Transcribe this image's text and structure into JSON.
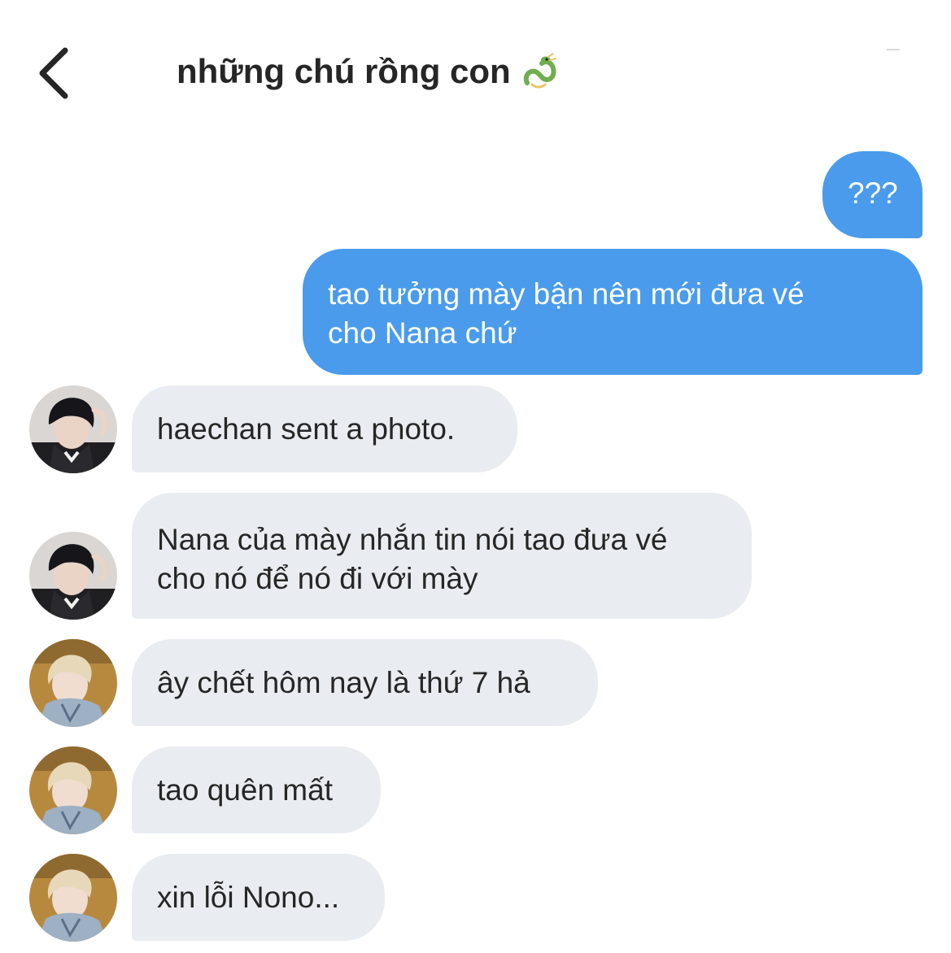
{
  "header": {
    "back_icon": "chevron-left-icon",
    "title": "những chú rồng con",
    "title_icon": "dragon-emoji-icon"
  },
  "messages": [
    {
      "direction": "outgoing",
      "text": "???"
    },
    {
      "direction": "outgoing",
      "text": "tao tưởng mày bận nên mới đưa vé\ncho Nana chứ"
    },
    {
      "direction": "incoming",
      "sender_avatar": "dark-hair-avatar",
      "text": "haechan sent a photo."
    },
    {
      "direction": "incoming",
      "sender_avatar": "dark-hair-avatar",
      "text": "Nana của mày nhắn tin nói tao đưa vé\ncho nó để nó đi với mày"
    },
    {
      "direction": "incoming",
      "sender_avatar": "blonde-hair-avatar",
      "text": "ây chết hôm nay là thứ 7 hả"
    },
    {
      "direction": "incoming",
      "sender_avatar": "blonde-hair-avatar",
      "text": "tao quên mất"
    },
    {
      "direction": "incoming",
      "sender_avatar": "blonde-hair-avatar",
      "text": "xin lỗi Nono..."
    }
  ],
  "colors": {
    "outgoing_bubble": "#4a9beb",
    "incoming_bubble": "#e9edf1",
    "text": "#262626"
  }
}
